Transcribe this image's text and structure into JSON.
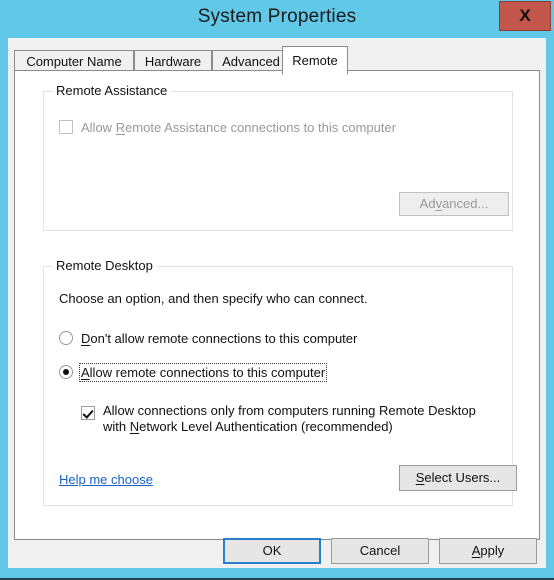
{
  "window": {
    "title": "System Properties",
    "close_label": "X",
    "titlebar_color": "#62c8e8",
    "close_color": "#c2564b"
  },
  "tabs": [
    {
      "label": "Computer Name",
      "active": false
    },
    {
      "label": "Hardware",
      "active": false
    },
    {
      "label": "Advanced",
      "active": false
    },
    {
      "label": "Remote",
      "active": true
    }
  ],
  "remote_assistance": {
    "caption": "Remote Assistance",
    "checkbox": {
      "label_before": "Allow ",
      "accel": "R",
      "label_after": "emote Assistance connections to this computer",
      "checked": false,
      "enabled": false
    },
    "advanced_button": {
      "label_before": "Ad",
      "accel": "v",
      "label_after": "anced...",
      "enabled": false
    }
  },
  "remote_desktop": {
    "caption": "Remote Desktop",
    "instruction": "Choose an option, and then specify who can connect.",
    "options": [
      {
        "label_before": "",
        "accel": "D",
        "label_after": "on't allow remote connections to this computer",
        "selected": false,
        "focused": false
      },
      {
        "label_before": "",
        "accel": "A",
        "label_after": "llow remote connections to this computer",
        "selected": true,
        "focused": true
      }
    ],
    "nla_checkbox": {
      "line1": "Allow connections only from computers running Remote Desktop",
      "line2_before": "with ",
      "line2_accel": "N",
      "line2_after": "etwork Level Authentication (recommended)",
      "checked": true
    },
    "help_link": "Help me choose",
    "select_users_button": {
      "label_before": "",
      "accel": "S",
      "label_after": "elect Users..."
    }
  },
  "footer": {
    "ok": {
      "label": "OK",
      "default": true
    },
    "cancel": {
      "label": "Cancel",
      "default": false
    },
    "apply": {
      "label_before": "",
      "accel": "A",
      "label_after": "pply",
      "default": false
    }
  }
}
